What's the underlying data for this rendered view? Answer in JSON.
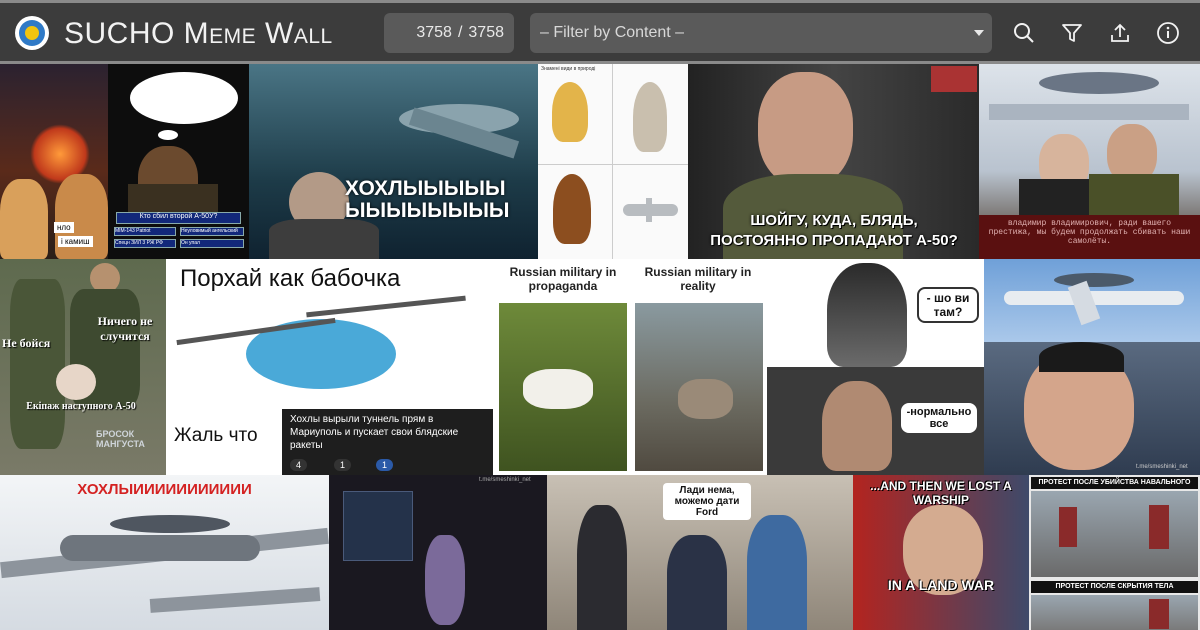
{
  "header": {
    "title": "SUCHO Meme Wall",
    "count_shown": "3758",
    "count_sep": "/",
    "count_total": "3758",
    "filter_placeholder": "– Filter by Content –",
    "icons": [
      "search-icon",
      "filter-icon",
      "upload-icon",
      "info-icon"
    ]
  },
  "memes": {
    "m1": {
      "line1": "нло",
      "line2": "i камиш"
    },
    "m2": {
      "question": "Кто сбил второй А-50У?",
      "opt1": "MIM-143 Patriot",
      "opt2": "Неуловимый ангельский огонь",
      "opt3": "Спецн ЗИЛ 3 РЖ РФ",
      "opt4": "Он упал"
    },
    "m3": {
      "line1": "ХОХЛЫЫЫЫЫ",
      "line2": "ЫЫЫЫЫЫЫЫ"
    },
    "m4": {
      "header": "Знамені види в природі"
    },
    "m5": {
      "line1": "ШОЙГУ, КУДА, БЛЯДЬ,",
      "line2": "ПОСТОЯННО ПРОПАДАЮТ А-50?"
    },
    "m6": {
      "text": "владимир владимирович, ради вашего престижа, мы будем продолжать сбивать наши самолёты."
    },
    "m7": {
      "left": "Не бойся",
      "right": "Ничего не случится",
      "bottom": "Екіпаж наступного А-50",
      "brand": "БРОСОК МАНГУСТА"
    },
    "m8": {
      "top": "Порхай как бабочка",
      "bottom": "Жаль что",
      "comment": "Хохлы вырыли туннель прям в Мариуполь и пускает свои блядские ракеты",
      "r1": "4",
      "r2": "1",
      "r3": "1"
    },
    "m9": {
      "left": "Russian military in propaganda",
      "right": "Russian military in reality"
    },
    "m10": {
      "bubble": "- шо ви там?"
    },
    "m11": {
      "bubble": "-нормально все"
    },
    "m13": {
      "watermark": "t.me/smeshinki_net"
    },
    "m14": {
      "title": "ХОХЛЫИИИИИИИИИИИ"
    },
    "m15": {
      "watermark": "t.me/smeshinki_net"
    },
    "m16": {
      "caption": "Лади нема, можемо дати Ford"
    },
    "m17": {
      "top": "...AND THEN WE LOST A WARSHIP",
      "bottom": "IN A LAND WAR"
    },
    "m18": {
      "top": "ПРОТЕСТ ПОСЛЕ УБИЙСТВА НАВАЛЬНОГО",
      "bottom": "ПРОТЕСТ ПОСЛЕ СКРЫТИЯ ТЕЛА НАВАЛЬНОГО"
    }
  },
  "colors": {
    "topbar": "#3c3c3c",
    "field": "#5a5a5a",
    "page": "#1e1e1e",
    "text": "#f2f2f2"
  }
}
